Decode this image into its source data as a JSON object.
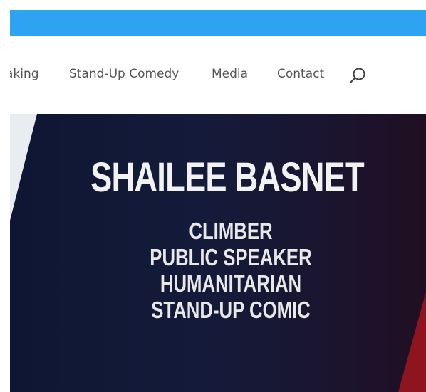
{
  "nav": {
    "items": [
      {
        "label": "aking"
      },
      {
        "label": "Stand-Up Comedy"
      },
      {
        "label": "Media"
      },
      {
        "label": "Contact"
      }
    ],
    "search_icon": "search-icon"
  },
  "hero": {
    "title": "SHAILEE BASNET",
    "roles": [
      "CLIMBER",
      "PUBLIC SPEAKER",
      "HUMANITARIAN",
      "STAND-UP COMIC"
    ]
  },
  "colors": {
    "top_bar": "#2ea3f2",
    "nav_text": "#555555",
    "hero_dark": "#0e1633",
    "hero_accent_red": "#8e1420",
    "hero_text": "#f2f2f2"
  }
}
